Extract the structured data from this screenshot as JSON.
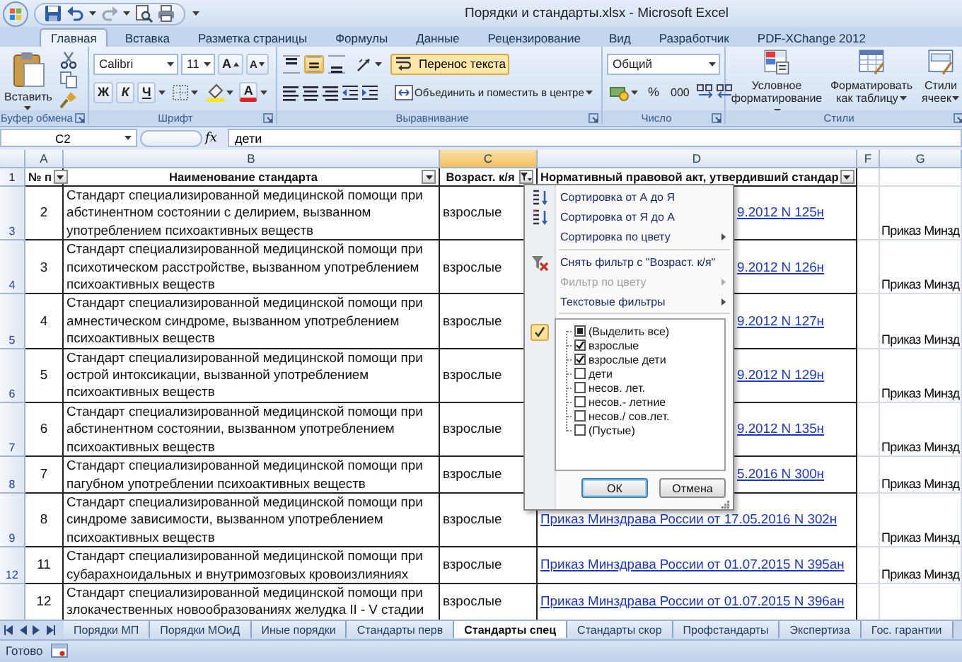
{
  "title_bar": {
    "title": "Порядки и стандарты.xlsx - Microsoft Excel"
  },
  "ribbon_tabs": [
    {
      "label": "Главная",
      "selected": true
    },
    {
      "label": "Вставка",
      "selected": false
    },
    {
      "label": "Разметка страницы",
      "selected": false
    },
    {
      "label": "Формулы",
      "selected": false
    },
    {
      "label": "Данные",
      "selected": false
    },
    {
      "label": "Рецензирование",
      "selected": false
    },
    {
      "label": "Вид",
      "selected": false
    },
    {
      "label": "Разработчик",
      "selected": false
    },
    {
      "label": "PDF-XChange 2012",
      "selected": false
    }
  ],
  "ribbon": {
    "clipboard": {
      "paste": "Вставить",
      "label": "Буфер обмена"
    },
    "font": {
      "name": "Calibri",
      "size": "11",
      "grow": "A",
      "shrink": "A",
      "bold": "Ж",
      "italic": "К",
      "underline": "Ч",
      "text_color_letter": "A",
      "label": "Шрифт"
    },
    "alignment": {
      "vertical_alignment": [
        {
          "kind": "top",
          "selected": false
        },
        {
          "kind": "middle",
          "selected": true
        },
        {
          "kind": "bottom",
          "selected": false
        }
      ],
      "wrap_text": {
        "label": "Перенос текста",
        "on": true
      },
      "merge": "Объединить и поместить в центре",
      "label": "Выравнивание"
    },
    "number": {
      "format": "Общий",
      "percent": "%",
      "thousands": "000",
      "label": "Число"
    },
    "styles": {
      "conditional": "Условное форматирование",
      "format_table": "Форматировать как таблицу",
      "cell_styles": "Стили ячеек",
      "label": "Стили"
    }
  },
  "formula_bar": {
    "name_box": "C2",
    "fx": "fx",
    "value": "дети"
  },
  "table": {
    "column_letters": [
      {
        "label": "A",
        "selected": false
      },
      {
        "label": "B",
        "selected": false
      },
      {
        "label": "C",
        "selected": true
      },
      {
        "label": "D",
        "selected": false
      },
      {
        "label": "F",
        "selected": false
      },
      {
        "label": "G",
        "selected": false
      }
    ],
    "header_row": "1",
    "header_cells": [
      {
        "text": "№ п",
        "filtered": false
      },
      {
        "text": "Наименование стандарта",
        "filtered": false
      },
      {
        "text": "Возраст. к/я",
        "filtered": true
      },
      {
        "text": "Нормативный правовой акт, утвердивший стандар",
        "filtered": false
      }
    ],
    "rows": [
      {
        "row": "3",
        "number": "2",
        "name": "Стандарт специализированной медицинской помощи при абстинентном состоянии с делирием, вызванном употреблением психоактивных веществ",
        "age": "взрослые",
        "act": "9.2012 N 125н",
        "act_covered": true,
        "column_g": "Приказ Минзд"
      },
      {
        "row": "4",
        "number": "3",
        "name": "Стандарт специализированной медицинской помощи при психотическом расстройстве, вызванном употреблением психоактивных веществ",
        "age": "взрослые",
        "act": "9.2012 N 126н",
        "act_covered": true,
        "column_g": "Приказ Минзд"
      },
      {
        "row": "5",
        "number": "4",
        "name": "Стандарт специализированной медицинской помощи при амнестическом синдроме, вызванном употреблением психоактивных веществ",
        "age": "взрослые",
        "act": "9.2012 N 127н",
        "act_covered": true,
        "column_g": "Приказ Минзд"
      },
      {
        "row": "6",
        "number": "5",
        "name": "Стандарт специализированной медицинской помощи при острой интоксикации, вызванной употреблением психоактивных веществ",
        "age": "взрослые",
        "act": "9.2012 N 129н",
        "act_covered": true,
        "column_g": "Приказ Минзд"
      },
      {
        "row": "7",
        "number": "6",
        "name": "Стандарт специализированной медицинской помощи при абстинентном состоянии, вызванном употреблением психоактивных веществ",
        "age": "взрослые",
        "act": "9.2012 N 135н",
        "act_covered": true,
        "column_g": "Приказ Минзд"
      },
      {
        "row": "8",
        "number": "7",
        "name": "Стандарт специализированной медицинской помощи при пагубном употреблении психоактивных веществ",
        "age": "взрослые",
        "act": "5.2016 N 300н",
        "act_covered": true,
        "column_g": "Приказ Минзд"
      },
      {
        "row": "9",
        "number": "8",
        "name": "Стандарт специализированной медицинской помощи при синдроме зависимости, вызванном употреблением психоактивных веществ",
        "age": "взрослые",
        "act": "Приказ Минздрава России от 17.05.2016 N 302н",
        "act_covered": false,
        "column_g": "Приказ Минзд"
      },
      {
        "row": "12",
        "number": "11",
        "name": "Стандарт специализированной медицинской помощи при субарахноидальных и внутримозговых кровоизлияниях",
        "age": "взрослые",
        "act": "Приказ Минздрава России от 01.07.2015 N 395ан",
        "act_covered": false,
        "column_g": "Приказ Минзд"
      },
      {
        "number": "12",
        "name": "Стандарт специализированной медицинской помощи при злокачественных новообразованиях желудка II - V стадии",
        "age": "взрослые",
        "act": "Приказ Минздрава России от 01.07.2015 N 396ан",
        "act_covered": false
      }
    ]
  },
  "filter_menu": {
    "sections": [
      [
        {
          "kind": "sort_asc",
          "label": "Сортировка от А до Я",
          "disabled": false,
          "submenu": false
        },
        {
          "kind": "sort_desc",
          "label": "Сортировка от Я до А",
          "disabled": false,
          "submenu": false
        },
        {
          "kind": "plain",
          "label": "Сортировка по цвету",
          "disabled": false,
          "submenu": true
        }
      ],
      [
        {
          "kind": "clear_filter",
          "label": "Снять фильтр с \"Возраст. к/я\"",
          "disabled": false,
          "submenu": false
        },
        {
          "kind": "plain",
          "label": "Фильтр по цвету",
          "disabled": true,
          "submenu": true
        },
        {
          "kind": "plain",
          "label": "Текстовые фильтры",
          "disabled": false,
          "submenu": true
        }
      ]
    ],
    "values_filter_active": true,
    "values": [
      {
        "label": "(Выделить все)",
        "checked": false,
        "partial": true
      },
      {
        "label": "взрослые",
        "checked": true,
        "partial": false
      },
      {
        "label": "взрослые дети",
        "checked": true,
        "partial": false
      },
      {
        "label": "дети",
        "checked": false,
        "partial": false
      },
      {
        "label": "несов. лет.",
        "checked": false,
        "partial": false
      },
      {
        "label": "несов.- летние",
        "checked": false,
        "partial": false
      },
      {
        "label": "несов./ сов.лет.",
        "checked": false,
        "partial": false
      },
      {
        "label": "(Пустые)",
        "checked": false,
        "partial": false
      }
    ],
    "ok": "ОК",
    "cancel": "Отмена"
  },
  "sheet_tabs": [
    {
      "label": "Порядки МП",
      "selected": false
    },
    {
      "label": "Порядки МОиД",
      "selected": false
    },
    {
      "label": "Иные порядки",
      "selected": false
    },
    {
      "label": "Стандарты перв",
      "selected": false
    },
    {
      "label": "Стандарты спец",
      "selected": true
    },
    {
      "label": "Стандарты скор",
      "selected": false
    },
    {
      "label": "Профстандарты",
      "selected": false
    },
    {
      "label": "Экспертиза",
      "selected": false
    },
    {
      "label": "Гос. гарантии",
      "selected": false
    }
  ],
  "status_bar": {
    "text": "Готово"
  }
}
